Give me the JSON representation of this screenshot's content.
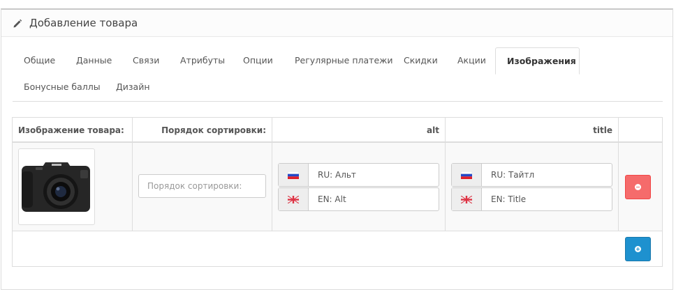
{
  "panel": {
    "title": "Добавление товара",
    "title_icon": "pencil-icon"
  },
  "tabs": [
    {
      "label": "Общие",
      "active": false
    },
    {
      "label": "Данные",
      "active": false
    },
    {
      "label": "Связи",
      "active": false
    },
    {
      "label": "Атрибуты",
      "active": false
    },
    {
      "label": "Опции",
      "active": false
    },
    {
      "label": "Регулярные платежи",
      "active": false
    },
    {
      "label": "Скидки",
      "active": false
    },
    {
      "label": "Акции",
      "active": false
    },
    {
      "label": "Изображения",
      "active": true
    },
    {
      "label": "Бонусные баллы",
      "active": false
    },
    {
      "label": "Дизайн",
      "active": false
    }
  ],
  "images_table": {
    "headers": {
      "image": "Изображение товара:",
      "sort_order": "Порядок сортировки:",
      "alt": "alt",
      "title": "title"
    },
    "rows": [
      {
        "thumbnail_icon": "camera-thumbnail",
        "sort_order_value": "",
        "sort_order_placeholder": "Порядок сортировки:",
        "alt": [
          {
            "flag": "ru-flag-icon",
            "value": "RU: Альт"
          },
          {
            "flag": "en-flag-icon",
            "value": "EN: Alt"
          }
        ],
        "title": [
          {
            "flag": "ru-flag-icon",
            "value": "RU: Тайтл"
          },
          {
            "flag": "en-flag-icon",
            "value": "EN: Title"
          }
        ],
        "remove_icon": "minus-circle-icon"
      }
    ],
    "add_icon": "plus-circle-icon"
  },
  "colors": {
    "remove_button": "#f56b6b",
    "add_button": "#1e91cf",
    "border": "#dddddd"
  }
}
